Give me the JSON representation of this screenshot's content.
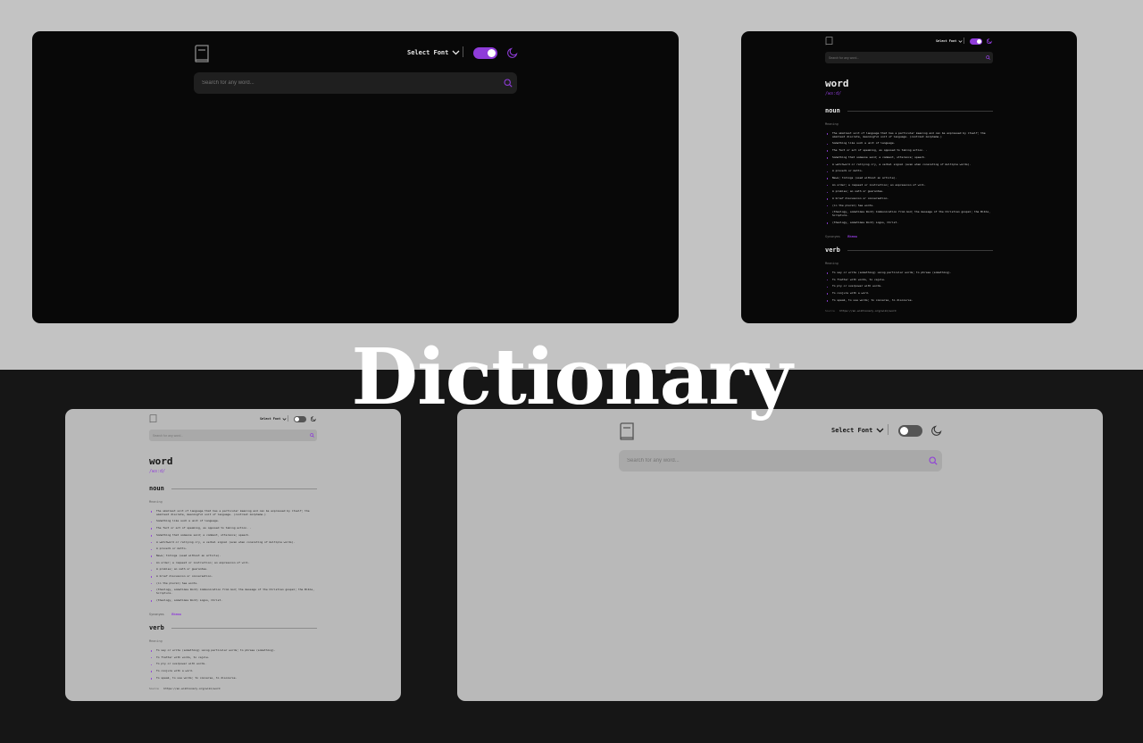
{
  "app_title": "Dictionary",
  "colors": {
    "accent": "#8f3cd9",
    "dark_bg": "#080808",
    "light_bg": "#b9b9b9",
    "top_band": "#c3c3c3",
    "bottom_band": "#161616"
  },
  "icons": {
    "logo": "book-icon",
    "search": "search-icon",
    "theme": "moon-icon",
    "dropdown": "chevron-down-icon"
  },
  "header": {
    "font_select_label": "Select Font"
  },
  "search": {
    "placeholder": "Search for any word..."
  },
  "result": {
    "word": "word",
    "phonetic": "/wɜːd/",
    "meaning_label": "Meaning",
    "synonyms_label": "Synonyms",
    "synonym": "Rhema",
    "source_label": "Source",
    "source_url": "https://en.wiktionary.org/wiki/word",
    "noun": {
      "label": "noun",
      "definitions": [
        "The smallest unit of language that has a particular meaning and can be expressed by itself; the smallest discrete, meaningful unit of language. (contrast morpheme.)",
        "Something like such a unit of language.",
        "The fact or act of speaking, as opposed to taking action. .",
        "Something that someone said; a comment, utterance; speech.",
        "A watchword or rallying cry, a verbal signal (even when consisting of multiple words).",
        "A proverb or motto.",
        "News; tidings (used without an article).",
        "An order; a request or instruction; an expression of will.",
        "A promise; an oath or guarantee.",
        "A brief discussion or conversation.",
        "(in the plural) See words.",
        "(theology, sometimes Word) Communication from God; the message of the Christian gospel; the Bible, Scripture.",
        "(theology, sometimes Word) Logos, Christ."
      ]
    },
    "verb": {
      "label": "verb",
      "definitions": [
        "To say or write (something) using particular words; to phrase (something).",
        "To flatter with words, to cajole.",
        "To ply or overpower with words.",
        "To conjure with a word.",
        "To speak, to use words; to converse, to discourse."
      ]
    }
  }
}
